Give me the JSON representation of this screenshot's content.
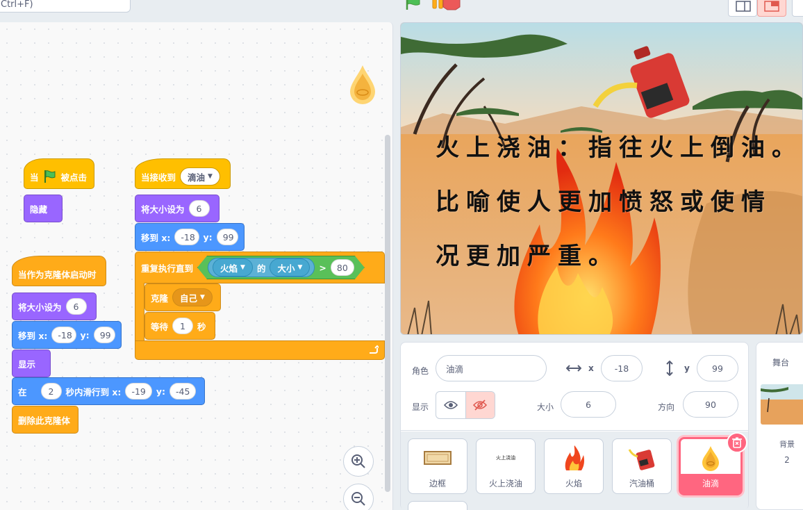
{
  "topbar": {
    "search_text": "Ctrl+F)"
  },
  "scripts": {
    "flag_script": {
      "when": "当",
      "clicked": "被点击",
      "hide": "隐藏"
    },
    "receive_script": {
      "when_receive": "当接收到",
      "message": "滴油",
      "set_size": "将大小设为",
      "size_value": "6",
      "goto": "移到 x:",
      "x": "-18",
      "y_label": "y:",
      "y": "99",
      "repeat_until": "重复执行直到",
      "sensing_target": "火焰",
      "of_label": "的",
      "property": "大小",
      "gt": ">",
      "compare_value": "80",
      "clone": "克隆",
      "clone_target": "自己",
      "wait": "等待",
      "wait_value": "1",
      "seconds": "秒"
    },
    "clone_script": {
      "hat": "当作为克隆体启动时",
      "set_size": "将大小设为",
      "size_value": "6",
      "goto": "移到 x:",
      "x": "-18",
      "y_label": "y:",
      "y": "99",
      "show": "显示",
      "glide_in": "在",
      "glide_secs": "2",
      "glide_to": "秒内滑行到 x:",
      "glide_x": "-19",
      "glide_y_label": "y:",
      "glide_y": "-45",
      "delete_clone": "删除此克隆体"
    }
  },
  "stage": {
    "lines": [
      "火上浇油：指往火上倒油。",
      "比喻使人更加愤怒或使情",
      "况更加严重。"
    ]
  },
  "sprite_info": {
    "sprite_label": "角色",
    "sprite_name": "油滴",
    "x_label": "x",
    "x_value": "-18",
    "y_label": "y",
    "y_value": "99",
    "show_label": "显示",
    "size_label": "大小",
    "size_value": "6",
    "direction_label": "方向",
    "direction_value": "90"
  },
  "sprites": [
    {
      "name": "边框"
    },
    {
      "name": "火上浇油",
      "thumb_text": "火上浇油"
    },
    {
      "name": "火焰"
    },
    {
      "name": "汽油桶"
    },
    {
      "name": "油滴",
      "selected": true
    }
  ],
  "stage_panel": {
    "title": "舞台",
    "backdrop_label": "背景",
    "backdrop_count": "2"
  },
  "colors": {
    "event": "#ffbf00",
    "looks": "#9966ff",
    "motion": "#4c97ff",
    "control": "#ffab19",
    "sensing": "#5cb1d6",
    "operator": "#59c059",
    "selected_sprite": "#ff6680"
  }
}
